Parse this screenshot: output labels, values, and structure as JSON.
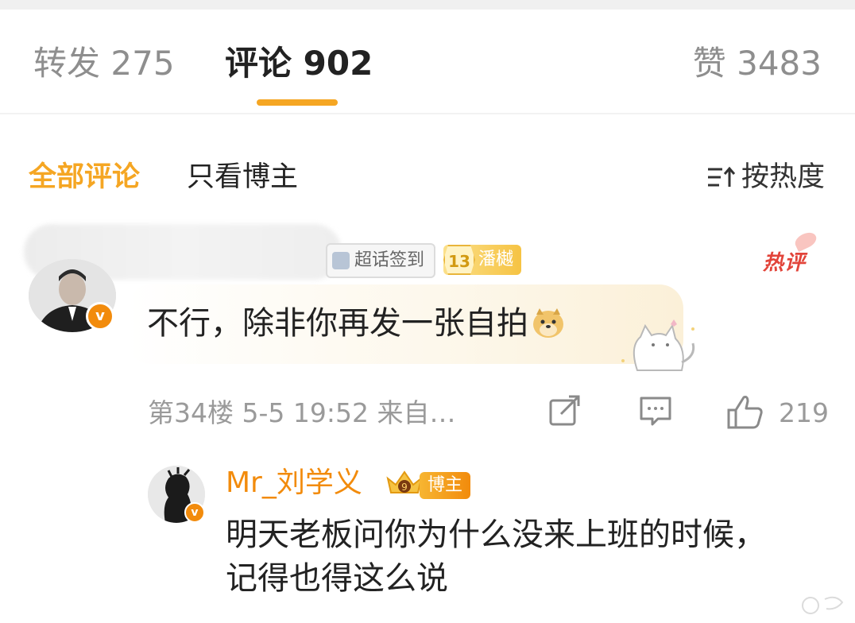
{
  "tabs": {
    "repost": {
      "label": "转发",
      "count": "275"
    },
    "comments": {
      "label": "评论",
      "count": "902"
    },
    "likes": {
      "label": "赞",
      "count": "3483"
    }
  },
  "filters": {
    "all": "全部评论",
    "op_only": "只看博主",
    "sort": "按热度"
  },
  "comment": {
    "badges": {
      "checkin": "超话签到",
      "fan_level": "13",
      "fan_name": "潘樾"
    },
    "hot_label": "热评",
    "text": "不行，除非你再发一张自拍",
    "emoji": "doge-emoji",
    "meta": "第34楼 5-5 19:52 来自…",
    "like_count": "219"
  },
  "reply": {
    "author": "Mr_刘学义",
    "author_tag": "博主",
    "crown_level": "9",
    "text": "明天老板问你为什么没来上班的时候，记得也得这么说"
  },
  "colors": {
    "accent": "#f5a623",
    "name_orange": "#f28b0c",
    "hot_red": "#e2443a",
    "muted": "#9a9a9a"
  }
}
